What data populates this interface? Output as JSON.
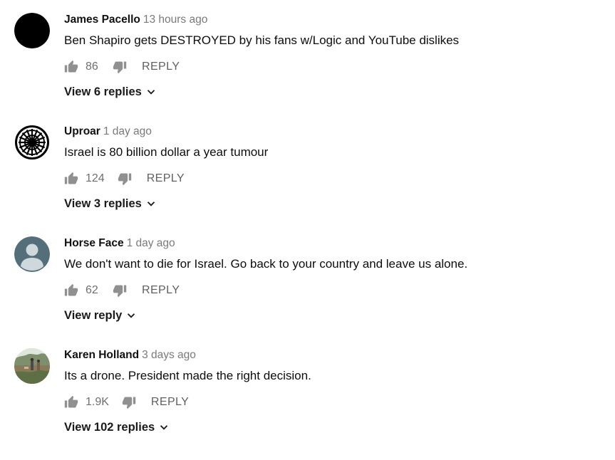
{
  "comments": [
    {
      "author": "James Pacello",
      "time": "13 hours ago",
      "text": "Ben Shapiro gets DESTROYED by his fans w/Logic and YouTube dislikes",
      "likes": "86",
      "reply_label": "REPLY",
      "view_replies": "View 6 replies",
      "avatar": "black-circle"
    },
    {
      "author": "Uproar",
      "time": "1 day ago",
      "text": "Israel is 80 billion dollar a year tumour",
      "likes": "124",
      "reply_label": "REPLY",
      "view_replies": "View 3 replies",
      "avatar": "sunwheel-emblem"
    },
    {
      "author": "Horse Face",
      "time": "1 day ago",
      "text": "We don't want to die for Israel. Go back to your country and leave us alone.",
      "likes": "62",
      "reply_label": "REPLY",
      "view_replies": "View reply",
      "avatar": "default-person"
    },
    {
      "author": "Karen Holland",
      "time": "3 days ago",
      "text": "Its a drone. President made the right decision.",
      "likes": "1.9K",
      "reply_label": "REPLY",
      "view_replies": "View 102 replies",
      "avatar": "outdoor-photo"
    }
  ],
  "icons": {
    "like": "thumbs-up-icon",
    "dislike": "thumbs-down-icon",
    "expand": "chevron-down-icon"
  },
  "colors": {
    "text": "#0d0d0d",
    "meta": "#7a7a7a",
    "action": "#6f6f6f",
    "default_avatar_bg": "#546e7a"
  }
}
